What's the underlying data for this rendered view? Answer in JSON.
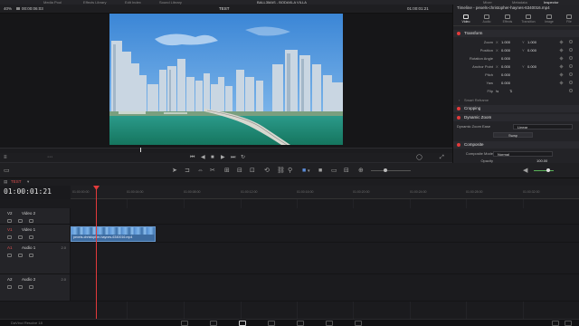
{
  "top_menu": [
    "Media Pool",
    "Effects Library",
    "Edit Index",
    "Sound Library",
    "BALL3MAS - BODAKLA VILLA",
    "Mixer",
    "Metadata",
    "Inspector"
  ],
  "viewer": {
    "zoom": "40%",
    "timecode_left": "00:00:06:03",
    "title": "TEST",
    "timecode_right": "01:00:01:21"
  },
  "inspector": {
    "title": "Timeline - pexels-christopher-haynes-6340016.mp4",
    "tabs": [
      "Video",
      "Audio",
      "Effects",
      "Transition",
      "Image",
      "File"
    ],
    "sections": {
      "transform": "Transform",
      "smart_reframe": "Smart Reframe",
      "cropping": "Cropping",
      "dynamic_zoom": "Dynamic Zoom",
      "composite": "Composite"
    },
    "params": [
      {
        "label": "Zoom",
        "ax": "X",
        "v1": "1.000",
        "ax2": "Y",
        "v2": "1.000"
      },
      {
        "label": "Position",
        "ax": "X",
        "v1": "0.000",
        "ax2": "Y",
        "v2": "0.000"
      },
      {
        "label": "Rotation Angle",
        "ax": "",
        "v1": "0.000",
        "ax2": "",
        "v2": ""
      },
      {
        "label": "Anchor Point",
        "ax": "X",
        "v1": "0.000",
        "ax2": "Y",
        "v2": "0.000"
      },
      {
        "label": "Pitch",
        "ax": "",
        "v1": "0.000",
        "ax2": "",
        "v2": ""
      },
      {
        "label": "Yaw",
        "ax": "",
        "v1": "0.000",
        "ax2": "",
        "v2": ""
      },
      {
        "label": "Flip",
        "ax": "",
        "v1": "",
        "ax2": "",
        "v2": ""
      }
    ],
    "dynamic_zoom_ease_label": "Dynamic Zoom Ease",
    "dynamic_zoom_ease_value": "Linear",
    "swap_label": "Swap",
    "composite_mode_label": "Composite Mode",
    "composite_mode_value": "Normal",
    "opacity_label": "Opacity",
    "opacity_value": "100.00"
  },
  "timeline": {
    "timecode": "01:00:01:21",
    "name": "TEST",
    "ruler_ticks": [
      "01:00:00:00",
      "01:00:04:00",
      "01:00:08:00",
      "01:00:12:00",
      "01:00:16:00",
      "01:00:20:00",
      "01:00:24:00",
      "01:00:28:00",
      "01:00:32:00"
    ],
    "tracks": [
      {
        "id": "V2",
        "name": "Video 2",
        "count": ""
      },
      {
        "id": "V1",
        "name": "Video 1",
        "count": "1 Clip"
      },
      {
        "id": "A1",
        "name": "Audio 1",
        "count": "2.0"
      },
      {
        "id": "A2",
        "name": "Audio 2",
        "count": "2.0"
      }
    ],
    "clip_name": "pexels-christopher-haynes-6340016.mp4"
  },
  "status": {
    "app": "DaVinci Resolve 18"
  },
  "colors": {
    "accent_red": "#e23b3b",
    "clip_blue": "#3e6ca0"
  }
}
